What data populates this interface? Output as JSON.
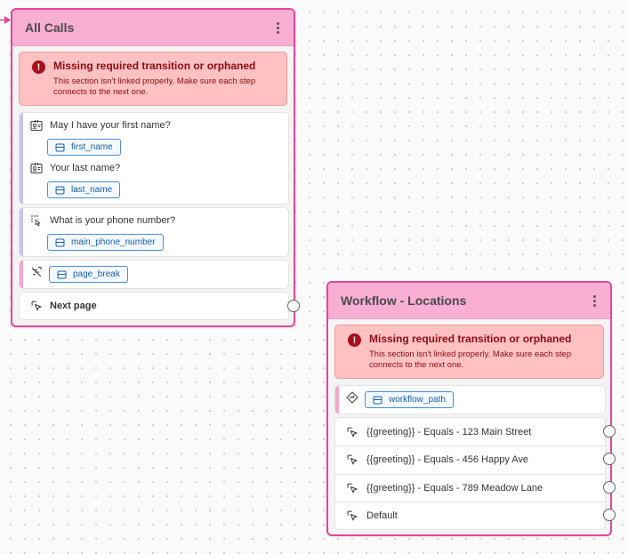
{
  "colors": {
    "node_border": "#e6479a",
    "node_header": "#f9aed3",
    "error_bg": "#ffc1c1",
    "error_text": "#8b0d16",
    "chip_border": "#4b8fd1"
  },
  "node_a": {
    "title": "All Calls",
    "error": {
      "title": "Missing required transition or orphaned",
      "description": "This section isn't linked properly. Make sure each step connects to the next one."
    },
    "steps": [
      {
        "question": "May I have your first name?",
        "variable": "first_name",
        "icon": "contact-card-icon"
      },
      {
        "question": "Your last name?",
        "variable": "last_name",
        "icon": "contact-card-icon"
      },
      {
        "question": "What is your phone number?",
        "variable": "main_phone_number",
        "icon": "dialpad-touch-icon"
      },
      {
        "variable": "page_break",
        "icon": "page-break-icon"
      }
    ],
    "next_label": "Next page"
  },
  "node_b": {
    "title": "Workflow - Locations",
    "error": {
      "title": "Missing required transition or orphaned",
      "description": "This section isn't linked properly. Make sure each step connects to the next one."
    },
    "path_variable": "workflow_path",
    "branches": [
      {
        "label": "{{greeting}} - Equals - 123 Main Street"
      },
      {
        "label": "{{greeting}} - Equals - 456 Happy Ave"
      },
      {
        "label": "{{greeting}} - Equals - 789 Meadow Lane"
      },
      {
        "label": "Default"
      }
    ]
  }
}
